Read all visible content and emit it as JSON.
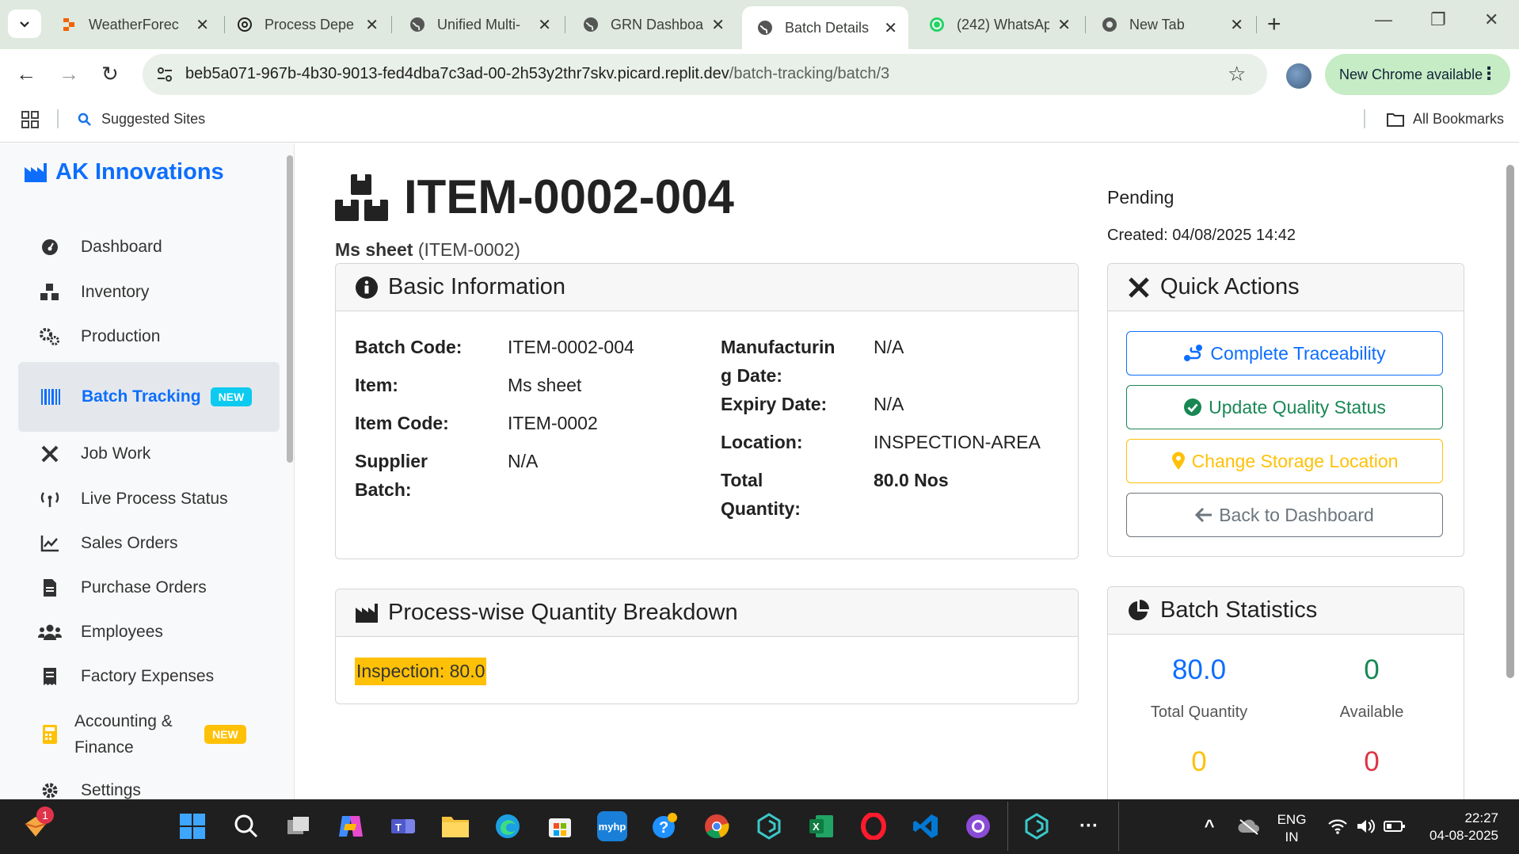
{
  "browser": {
    "tabs": [
      {
        "label": "WeatherForec",
        "icon": "replit-icon"
      },
      {
        "label": "Process Depe",
        "icon": "openai-icon"
      },
      {
        "label": "Unified Multi-",
        "icon": "globe-icon"
      },
      {
        "label": "GRN Dashboa",
        "icon": "globe-icon"
      },
      {
        "label": "Batch Details",
        "icon": "globe-icon"
      },
      {
        "label": "(242) WhatsAp",
        "icon": "whatsapp-icon"
      },
      {
        "label": "New Tab",
        "icon": "chrome-icon"
      }
    ],
    "url_host": "beb5a071-967b-4b30-9013-fed4dba7c3ad-00-2h53y2thr7skv.picard.replit.dev",
    "url_path": "/batch-tracking/batch/3",
    "update_label": "New Chrome available",
    "bookmarks": {
      "suggested": "Suggested Sites",
      "all": "All Bookmarks"
    }
  },
  "sidebar": {
    "brand": "AK Innovations",
    "items": [
      {
        "label": "Dashboard",
        "icon": "dashboard-icon"
      },
      {
        "label": "Inventory",
        "icon": "boxes-icon"
      },
      {
        "label": "Production",
        "icon": "cogs-icon"
      },
      {
        "label": "Batch Tracking",
        "icon": "barcode-icon",
        "badge": "NEW"
      },
      {
        "label": "Job Work",
        "icon": "tools-icon"
      },
      {
        "label": "Live Process Status",
        "icon": "broadcast-icon"
      },
      {
        "label": "Sales Orders",
        "icon": "chart-line-icon"
      },
      {
        "label": "Purchase Orders",
        "icon": "file-icon"
      },
      {
        "label": "Employees",
        "icon": "users-icon"
      },
      {
        "label": "Factory Expenses",
        "icon": "receipt-icon"
      },
      {
        "label_line1": "Accounting &",
        "label_line2": "Finance",
        "icon": "calculator-icon",
        "badge": "NEW"
      },
      {
        "label": "Settings",
        "icon": "gear-icon"
      }
    ]
  },
  "header": {
    "title": "ITEM-0002-004",
    "item_name": "Ms sheet",
    "item_code": "(ITEM-0002)",
    "status": "Pending",
    "created": "Created: 04/08/2025 14:42"
  },
  "basic_info": {
    "title": "Basic Information",
    "labels": {
      "batch_code": "Batch Code:",
      "item": "Item:",
      "item_code": "Item Code:",
      "supplier_batch_1": "Supplier",
      "supplier_batch_2": "Batch:",
      "mfg_1": "Manufacturin",
      "mfg_2": "g Date:",
      "expiry": "Expiry Date:",
      "location": "Location:",
      "total_qty_1": "Total",
      "total_qty_2": "Quantity:"
    },
    "values": {
      "batch_code": "ITEM-0002-004",
      "item": "Ms sheet",
      "item_code": "ITEM-0002",
      "supplier_batch": "N/A",
      "mfg_date": "N/A",
      "expiry": "N/A",
      "location": "INSPECTION-AREA",
      "total_qty": "80.0 Nos"
    }
  },
  "breakdown": {
    "title": "Process-wise Quantity Breakdown",
    "item": "Inspection: 80.0"
  },
  "quick_actions": {
    "title": "Quick Actions",
    "buttons": {
      "traceability": "Complete Traceability",
      "quality": "Update Quality Status",
      "location": "Change Storage Location",
      "back": "Back to Dashboard"
    }
  },
  "stats": {
    "title": "Batch Statistics",
    "total_quantity": "80.0",
    "total_quantity_label": "Total Quantity",
    "available": "0",
    "available_label": "Available",
    "third": "0",
    "fourth": "0"
  },
  "taskbar": {
    "notification_count": "1",
    "lang_1": "ENG",
    "lang_2": "IN",
    "time": "22:27",
    "date": "04-08-2025"
  },
  "colors": {
    "primary": "#0d6efd",
    "success": "#198754",
    "warning": "#ffc107",
    "danger": "#dc3545",
    "secondary": "#6c757d",
    "chrome_bg": "#dfe9df"
  }
}
